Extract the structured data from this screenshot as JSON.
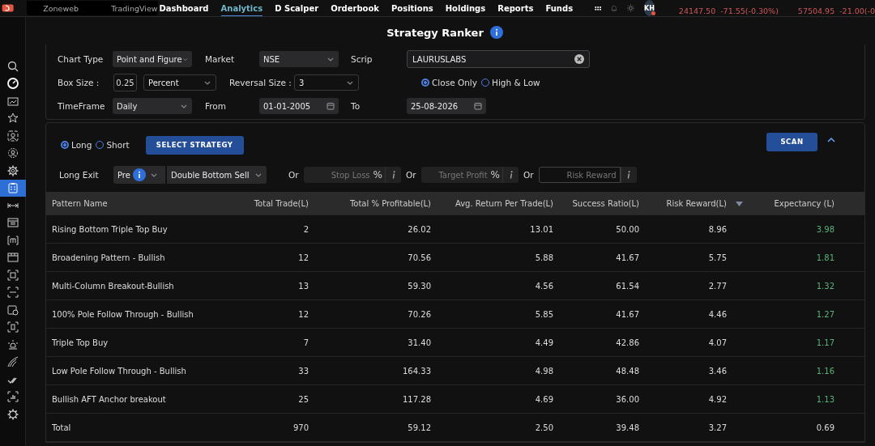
{
  "topbar": {
    "quick_links": [
      "Zoneweb",
      "TradingView"
    ],
    "nav": [
      {
        "label": "Dashboard",
        "selected": false
      },
      {
        "label": "Analytics",
        "selected": true
      },
      {
        "label": "D Scalper",
        "selected": false
      },
      {
        "label": "Orderbook",
        "selected": false
      },
      {
        "label": "Positions",
        "selected": false
      },
      {
        "label": "Holdings",
        "selected": false
      },
      {
        "label": "Reports",
        "selected": false
      },
      {
        "label": "Funds",
        "selected": false
      }
    ],
    "avatar": "KH",
    "notification_dot": true,
    "tickers": [
      {
        "price": "24147.50",
        "change": "-71.55(-0.30%)"
      },
      {
        "price": "57504.95",
        "change": "-21.00(-0"
      }
    ]
  },
  "sidebar": {
    "items": [
      {
        "selected": false
      },
      {
        "selected": false
      },
      {
        "selected": false
      },
      {
        "selected": false
      },
      {
        "selected": false
      },
      {
        "selected": false
      },
      {
        "selected": false
      },
      {
        "selected": true
      },
      {
        "selected": false
      },
      {
        "selected": false
      },
      {
        "selected": false
      },
      {
        "selected": false
      },
      {
        "selected": false
      },
      {
        "selected": false
      },
      {
        "selected": false
      },
      {
        "selected": false
      },
      {
        "selected": false
      },
      {
        "selected": false
      },
      {
        "selected": false
      },
      {
        "selected": false
      },
      {
        "selected": false
      }
    ]
  },
  "page_title": "Strategy Ranker",
  "form": {
    "chart_type": {
      "label": "Chart Type",
      "value": "Point and Figure"
    },
    "market": {
      "label": "Market",
      "value": "NSE"
    },
    "scrip": {
      "label": "Scrip",
      "value": "LAURUSLABS"
    },
    "box_size": {
      "label": "Box Size :",
      "value": "0.25",
      "unit": "Percent"
    },
    "reversal_size": {
      "label": "Reversal Size :",
      "value": "3"
    },
    "price_basis": [
      {
        "label": "Close Only",
        "selected": true
      },
      {
        "label": "High & Low",
        "selected": false
      }
    ],
    "timeframe": {
      "label": "TimeFrame",
      "value": "Daily"
    },
    "from": {
      "label": "From",
      "value": "01-01-2005"
    },
    "to": {
      "label": "To",
      "value": "25-08-2026"
    }
  },
  "strategy": {
    "direction": [
      {
        "label": "Long",
        "selected": true
      },
      {
        "label": "Short",
        "selected": false
      }
    ],
    "select_button": "SELECT STRATEGY",
    "scan_button": "SCAN",
    "exit_label": "Long Exit",
    "exit_mode": "Pre",
    "exit_pattern": "Double Bottom Sell",
    "alternatives": [
      {
        "or": "Or",
        "placeholder": "Stop Loss",
        "unit": "%"
      },
      {
        "or": "Or",
        "placeholder": "Target Profit",
        "unit": "%"
      },
      {
        "or": "Or",
        "placeholder": "Risk Reward"
      }
    ]
  },
  "table": {
    "columns": [
      {
        "label": "Pattern Name",
        "sorted": false
      },
      {
        "label": "Total Trade(L)",
        "sorted": false
      },
      {
        "label": "Total % Profitable(L)",
        "sorted": false
      },
      {
        "label": "Avg. Return Per Trade(L)",
        "sorted": false
      },
      {
        "label": "Success Ratio(L)",
        "sorted": false
      },
      {
        "label": "Risk Reward(L)",
        "sorted": true
      },
      {
        "label": "Expectancy (L)",
        "sorted": false
      }
    ],
    "rows": [
      {
        "kind": "data",
        "cells": [
          "Rising Bottom Triple Top Buy",
          "2",
          "26.02",
          "13.01",
          "50.00",
          "8.96",
          "3.98"
        ]
      },
      {
        "kind": "data",
        "cells": [
          "Broadening Pattern - Bullish",
          "12",
          "70.56",
          "5.88",
          "41.67",
          "5.75",
          "1.81"
        ]
      },
      {
        "kind": "data",
        "cells": [
          "Multi-Column Breakout-Bullish",
          "13",
          "59.30",
          "4.56",
          "61.54",
          "2.77",
          "1.32"
        ]
      },
      {
        "kind": "data",
        "cells": [
          "100% Pole Follow Through - Bullish",
          "12",
          "70.26",
          "5.85",
          "41.67",
          "4.46",
          "1.27"
        ]
      },
      {
        "kind": "data",
        "cells": [
          "Triple Top Buy",
          "7",
          "31.40",
          "4.49",
          "42.86",
          "4.07",
          "1.17"
        ]
      },
      {
        "kind": "data",
        "cells": [
          "Low Pole Follow Through - Bullish",
          "33",
          "164.33",
          "4.98",
          "48.48",
          "3.46",
          "1.16"
        ]
      },
      {
        "kind": "data",
        "cells": [
          "Bullish AFT Anchor breakout",
          "25",
          "117.28",
          "4.69",
          "36.00",
          "4.92",
          "1.13"
        ]
      },
      {
        "kind": "total",
        "cells": [
          "Total",
          "970",
          "59.12",
          "2.50",
          "39.48",
          "3.27",
          "0.69"
        ]
      }
    ]
  }
}
